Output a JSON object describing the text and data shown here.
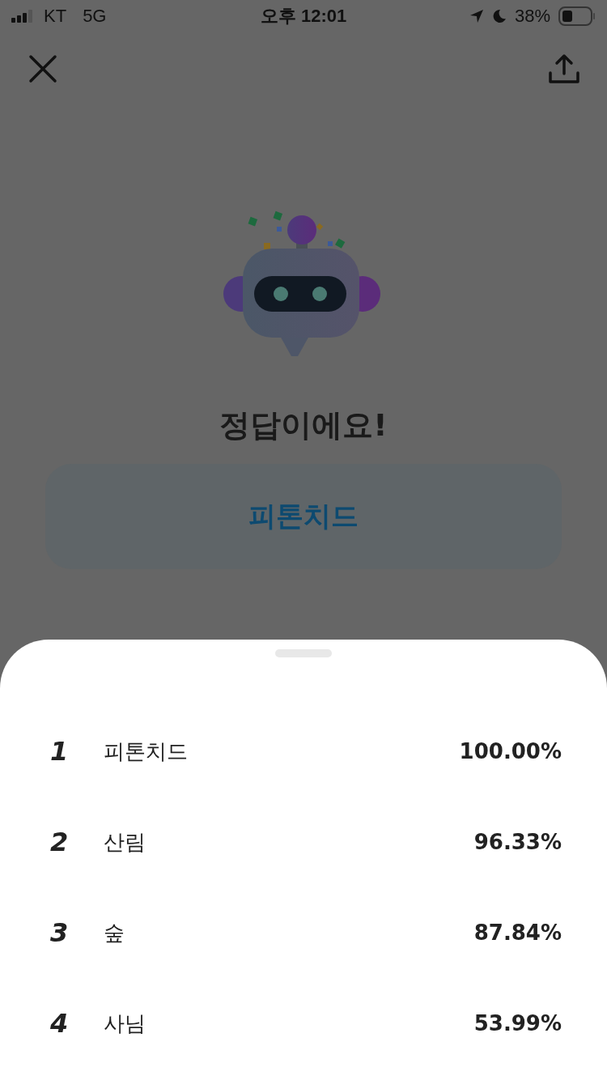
{
  "status_bar": {
    "carrier": "KT",
    "network": "5G",
    "time": "오후 12:01",
    "battery": "38%"
  },
  "result": {
    "title": "정답이에요!",
    "answer": "피톤치드"
  },
  "ranking": [
    {
      "rank": "1",
      "word": "피톤치드",
      "score": "100.00%"
    },
    {
      "rank": "2",
      "word": "산림",
      "score": "96.33%"
    },
    {
      "rank": "3",
      "word": "숲",
      "score": "87.84%"
    },
    {
      "rank": "4",
      "word": "사님",
      "score": "53.99%"
    }
  ]
}
